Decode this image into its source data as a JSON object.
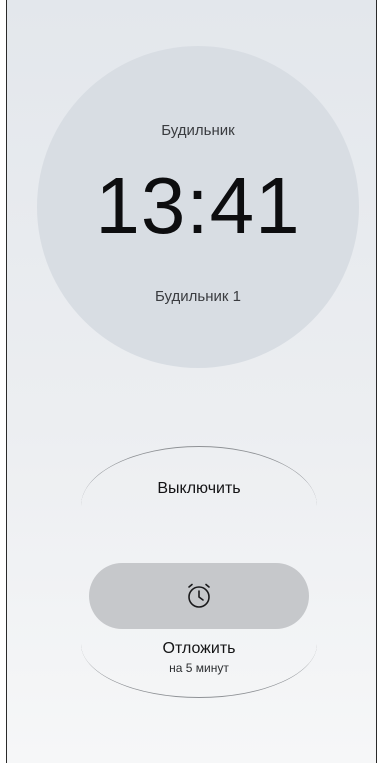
{
  "alarm": {
    "header": "Будильник",
    "time": "13:41",
    "name": "Будильник 1"
  },
  "actions": {
    "dismiss_label": "Выключить",
    "snooze_label": "Отложить",
    "snooze_duration": "на 5 минут",
    "snooze_icon": "alarm-clock-icon"
  },
  "colors": {
    "circle": "#d8dde3",
    "snooze_pill": "#c6c8cb",
    "text": "#141416"
  }
}
